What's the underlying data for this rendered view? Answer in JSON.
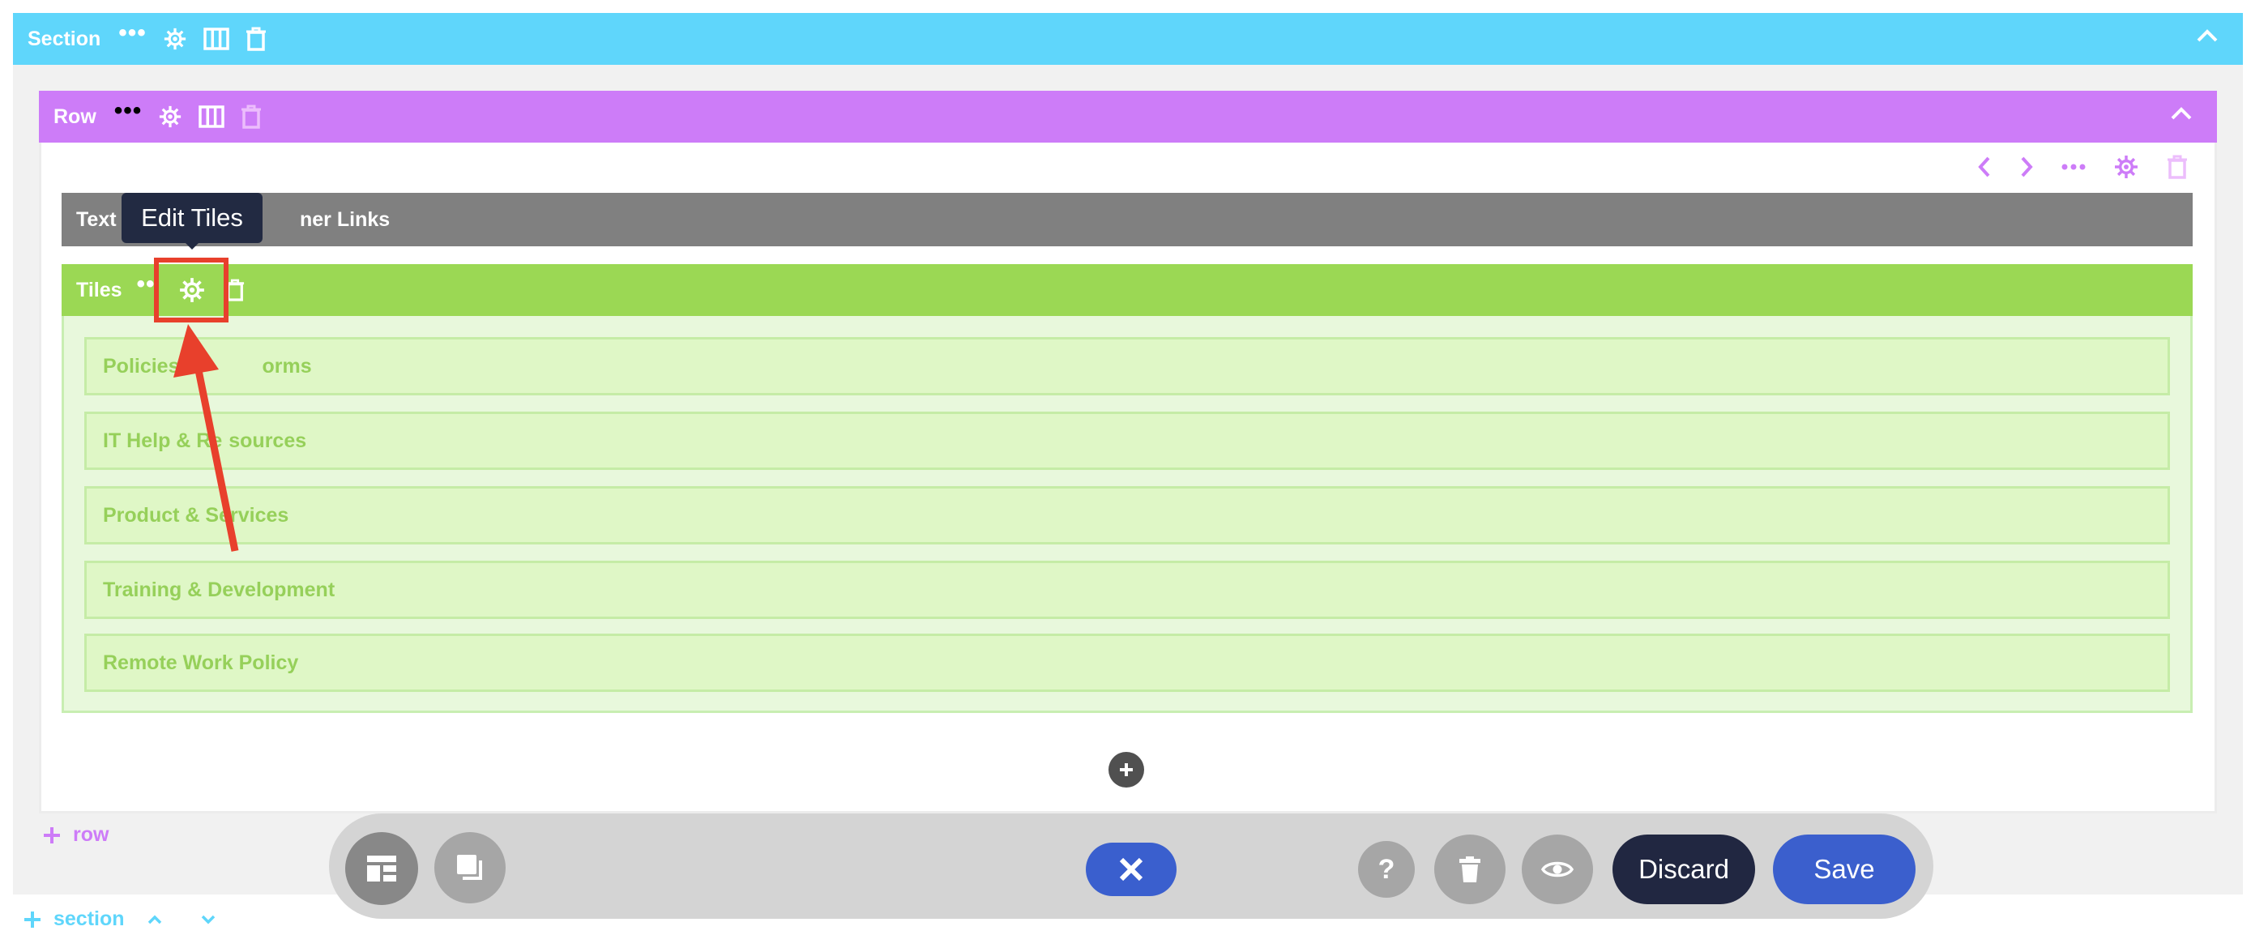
{
  "section": {
    "label": "Section",
    "dots": "•••",
    "add_label": "section"
  },
  "row": {
    "label": "Row",
    "dots": "•••",
    "add_label": "row"
  },
  "text_module": {
    "label_start": "Text",
    "label_end": "ner Links"
  },
  "tooltip": {
    "text": "Edit Tiles"
  },
  "tiles": {
    "label": "Tiles",
    "dots": "••",
    "items": [
      {
        "label": "Policies",
        "label_end": "orms"
      },
      {
        "label": "IT Help & Re",
        "label_end": "sources"
      },
      {
        "label": "Product & Se",
        "label_end": "rvices"
      },
      {
        "label": "Training & Development",
        "label_end": ""
      },
      {
        "label": "Remote Work Policy",
        "label_end": ""
      }
    ]
  },
  "toolbar": {
    "discard_label": "Discard",
    "save_label": "Save",
    "help_symbol": "?"
  },
  "colors": {
    "section": "#5fd6fb",
    "row": "#cd7cf8",
    "tiles": "#9bd854",
    "text_module": "#808080",
    "highlight": "#e8402c",
    "save": "#3b5fcd",
    "discard": "#212741"
  },
  "icons": [
    "gear-icon",
    "columns-icon",
    "trash-icon",
    "chevron-up-icon",
    "chevron-left-icon",
    "chevron-right-icon",
    "plus-icon",
    "layout-icon",
    "copy-icon",
    "close-icon",
    "help-icon",
    "eye-icon"
  ]
}
